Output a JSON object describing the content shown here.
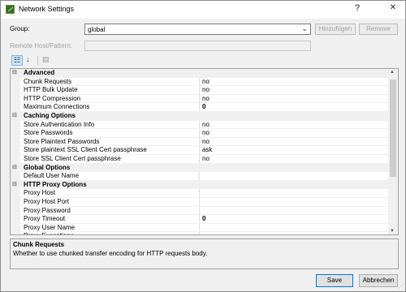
{
  "window": {
    "title": "Network Settings",
    "help": "?",
    "close": "✕"
  },
  "form": {
    "group_label": "Group:",
    "group_value": "global",
    "add_button": "Hinzufügen",
    "remove_button": "Remove",
    "remote_label": "Remote Host/Pattern:",
    "remote_value": ""
  },
  "grid": {
    "rows": [
      {
        "type": "category",
        "name": "Advanced"
      },
      {
        "type": "property",
        "name": "Chunk Requests",
        "value": "no",
        "selected": true
      },
      {
        "type": "property",
        "name": "HTTP Bulk Update",
        "value": "no"
      },
      {
        "type": "property",
        "name": "HTTP Compression",
        "value": "no"
      },
      {
        "type": "property",
        "name": "Maximum Connections",
        "value": "0",
        "bold": true
      },
      {
        "type": "category",
        "name": "Caching Options"
      },
      {
        "type": "property",
        "name": "Store Authentication Info",
        "value": "no"
      },
      {
        "type": "property",
        "name": "Store Passwords",
        "value": "no"
      },
      {
        "type": "property",
        "name": "Store Plaintext Passwords",
        "value": "no"
      },
      {
        "type": "property",
        "name": "Store plaintext SSL Client Cert passphrase",
        "value": "ask"
      },
      {
        "type": "property",
        "name": "Store SSL Client Cert passphrase",
        "value": "no"
      },
      {
        "type": "category",
        "name": "Global Options"
      },
      {
        "type": "property",
        "name": "Default User Name",
        "value": ""
      },
      {
        "type": "category",
        "name": "HTTP Proxy Options"
      },
      {
        "type": "property",
        "name": "Proxy Host",
        "value": ""
      },
      {
        "type": "property",
        "name": "Proxy Host Port",
        "value": ""
      },
      {
        "type": "property",
        "name": "Proxy Password",
        "value": ""
      },
      {
        "type": "property",
        "name": "Proxy Timeout",
        "value": "0",
        "bold": true
      },
      {
        "type": "property",
        "name": "Proxy User Name",
        "value": ""
      },
      {
        "type": "property",
        "name": "Proxy Exceptions",
        "value": ""
      }
    ]
  },
  "description": {
    "title": "Chunk Requests",
    "text": "Whether to use chunked transfer encoding for HTTP requests body."
  },
  "buttons": {
    "save": "Save",
    "cancel": "Abbrechen"
  }
}
